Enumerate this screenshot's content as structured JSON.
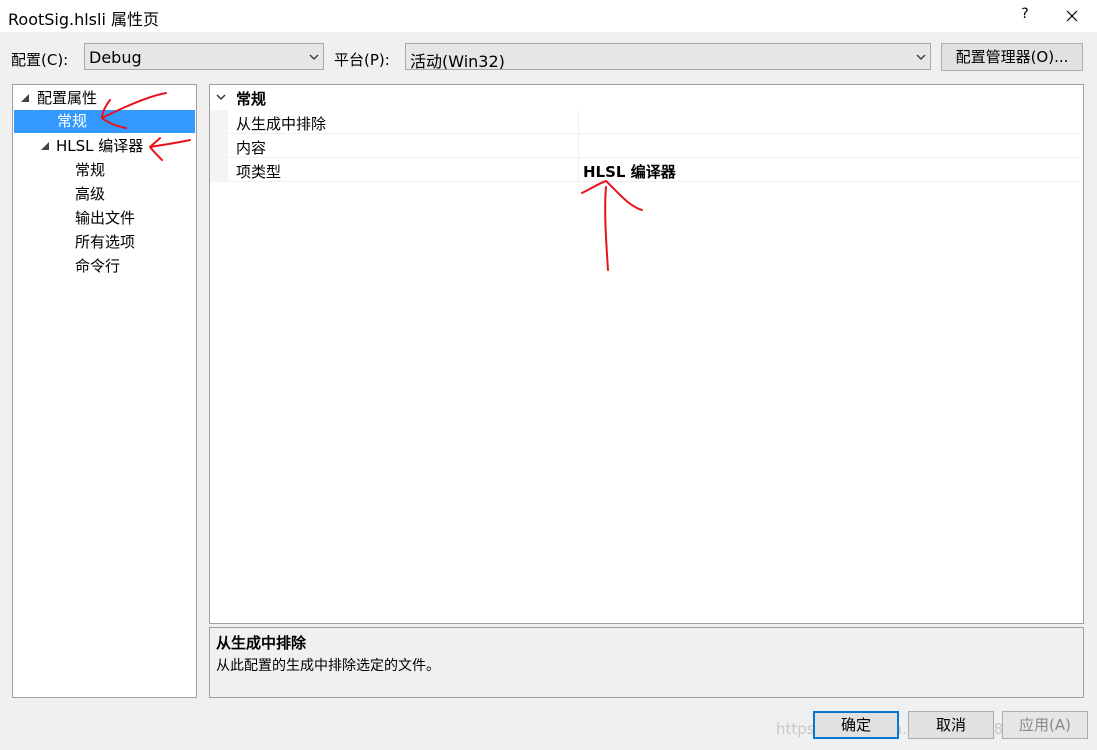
{
  "window": {
    "title": "RootSig.hlsli 属性页",
    "help": "?"
  },
  "toolbar": {
    "config_label": "配置(C):",
    "config_value": "Debug",
    "platform_label": "平台(P):",
    "platform_value": "活动(Win32)",
    "config_manager_button": "配置管理器(O)..."
  },
  "tree": {
    "root": "配置属性",
    "general": "常规",
    "hlsl": "HLSL 编译器",
    "children": [
      "常规",
      "高级",
      "输出文件",
      "所有选项",
      "命令行"
    ]
  },
  "grid": {
    "category": "常规",
    "rows": [
      {
        "name": "从生成中排除",
        "value": ""
      },
      {
        "name": "内容",
        "value": ""
      },
      {
        "name": "项类型",
        "value": "HLSL 编译器"
      }
    ]
  },
  "description": {
    "title": "从生成中排除",
    "text": "从此配置的生成中排除选定的文件。"
  },
  "buttons": {
    "ok": "确定",
    "cancel": "取消",
    "apply": "应用(A)"
  },
  "watermark": "https://blog.csdn.net/u012918933",
  "colors": {
    "selection": "#3399ff",
    "annotation": "#e8141c"
  },
  "icons": {
    "close": "close-icon",
    "dropdown": "chevron-down-icon",
    "expander": "triangle-expander-icon"
  }
}
